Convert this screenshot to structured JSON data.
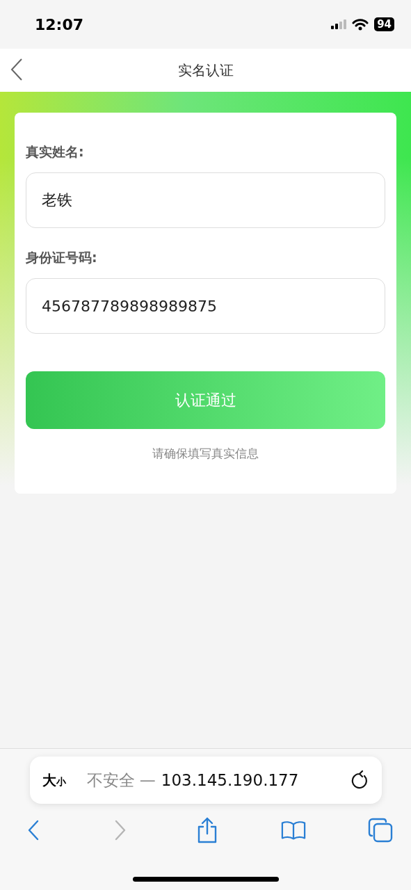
{
  "status_bar": {
    "time": "12:07",
    "battery": "94"
  },
  "header": {
    "title": "实名认证"
  },
  "form": {
    "fields": [
      {
        "label": "真实姓名:",
        "value": "老铁"
      },
      {
        "label": "身份证号码:",
        "value": "456787789898989875"
      }
    ],
    "submit": "认证通过",
    "note": "请确保填写真实信息"
  },
  "browser": {
    "text_size": {
      "large": "大",
      "small": "小"
    },
    "security": "不安全 —",
    "host": "103.145.190.177",
    "toolbar": [
      {
        "kind": "back",
        "disabled": false
      },
      {
        "kind": "forward",
        "disabled": true
      },
      {
        "kind": "share",
        "disabled": false
      },
      {
        "kind": "bookmarks",
        "disabled": false
      },
      {
        "kind": "tabs",
        "disabled": false
      }
    ]
  }
}
